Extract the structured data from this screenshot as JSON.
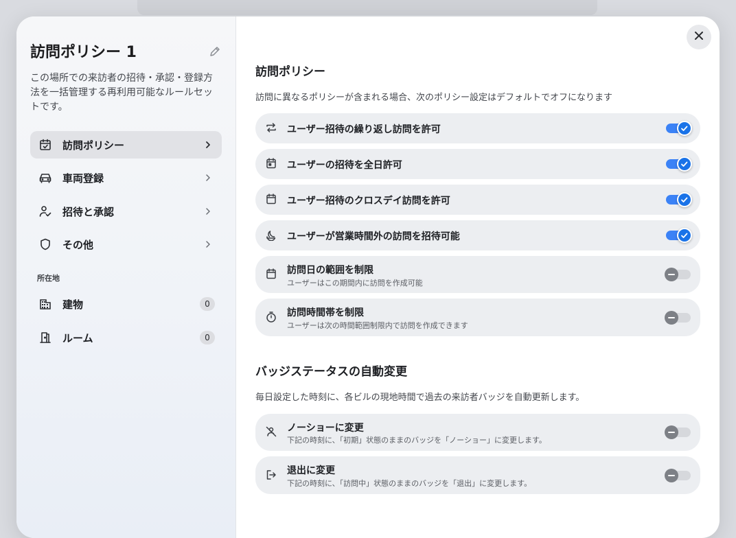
{
  "sidebar": {
    "title": "訪問ポリシー 1",
    "description": "この場所での来訪者の招待・承認・登録方法を一括管理する再利用可能なルールセットです。",
    "nav": [
      {
        "label": "訪問ポリシー",
        "icon": "calendar-check-icon",
        "active": true
      },
      {
        "label": "車両登録",
        "icon": "car-icon",
        "active": false
      },
      {
        "label": "招待と承認",
        "icon": "user-check-icon",
        "active": false
      },
      {
        "label": "その他",
        "icon": "shield-icon",
        "active": false
      }
    ],
    "location_label": "所在地",
    "locations": [
      {
        "label": "建物",
        "icon": "building-icon",
        "count": "0"
      },
      {
        "label": "ルーム",
        "icon": "door-icon",
        "count": "0"
      }
    ]
  },
  "policy": {
    "title": "訪問ポリシー",
    "description": "訪問に異なるポリシーが含まれる場合、次のポリシー設定はデフォルトでオフになります",
    "rows": [
      {
        "label": "ユーザー招待の繰り返し訪問を許可",
        "sub": "",
        "icon": "repeat-icon",
        "enabled": true
      },
      {
        "label": "ユーザーの招待を全日許可",
        "sub": "",
        "icon": "calendar-day-icon",
        "enabled": true
      },
      {
        "label": "ユーザー招待のクロスデイ訪問を許可",
        "sub": "",
        "icon": "calendar-icon",
        "enabled": true
      },
      {
        "label": "ユーザーが営業時間外の訪問を招待可能",
        "sub": "",
        "icon": "moon-icon",
        "enabled": true
      },
      {
        "label": "訪問日の範囲を制限",
        "sub": "ユーザーはこの期間内に訪問を作成可能",
        "icon": "calendar-range-icon",
        "enabled": false
      },
      {
        "label": "訪問時間帯を制限",
        "sub": "ユーザーは次の時間範囲制限内で訪問を作成できます",
        "icon": "timer-icon",
        "enabled": false
      }
    ]
  },
  "badge": {
    "title": "バッジステータスの自動変更",
    "description": "毎日設定した時刻に、各ビルの現地時間で過去の来訪者バッジを自動更新します。",
    "rows": [
      {
        "label": "ノーショーに変更",
        "sub": "下記の時刻に、「初期」状態のままのバッジを「ノーショー」に変更します。",
        "icon": "user-off-icon",
        "enabled": false
      },
      {
        "label": "退出に変更",
        "sub": "下記の時刻に、「訪問中」状態のままのバッジを「退出」に変更します。",
        "icon": "logout-icon",
        "enabled": false
      }
    ]
  },
  "colors": {
    "accent": "#1a73e8",
    "row_bg": "#eceef1",
    "sidebar_bg": "#f3f5f8"
  }
}
